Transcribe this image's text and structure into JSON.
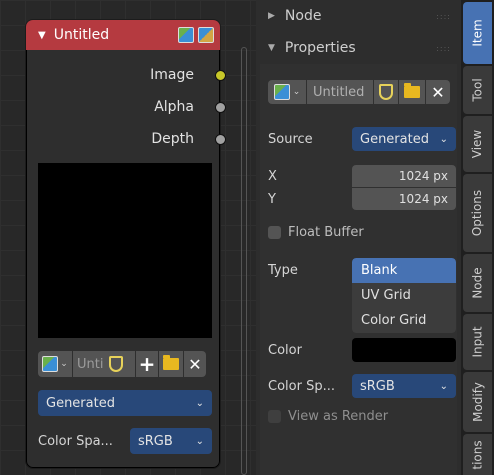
{
  "node": {
    "title": "Untitled",
    "sockets": [
      "Image",
      "Alpha",
      "Depth"
    ],
    "image_name": "Unti",
    "source_value": "Generated",
    "colorspace_label": "Color Spa...",
    "colorspace_value": "sRGB"
  },
  "sidebar": {
    "node_panel": "Node",
    "properties_panel": "Properties",
    "image_name": "Untitled",
    "source_label": "Source",
    "source_value": "Generated",
    "x_label": "X",
    "x_value": "1024 px",
    "y_label": "Y",
    "y_value": "1024 px",
    "float_buffer_label": "Float Buffer",
    "type_label": "Type",
    "type_options": [
      "Blank",
      "UV Grid",
      "Color Grid"
    ],
    "type_selected": "Blank",
    "color_label": "Color",
    "color_value": "#000000",
    "colorspace_label": "Color Sp...",
    "colorspace_value": "sRGB",
    "view_as_render_label": "View as Render"
  },
  "tabs": [
    "Item",
    "Tool",
    "View",
    "Options",
    "Node",
    "Input",
    "Modify",
    "tions"
  ],
  "active_tab": "Item",
  "colors": {
    "node_header": "#b53a40",
    "accent": "#4772b3",
    "socket_image": "#c7c729"
  }
}
